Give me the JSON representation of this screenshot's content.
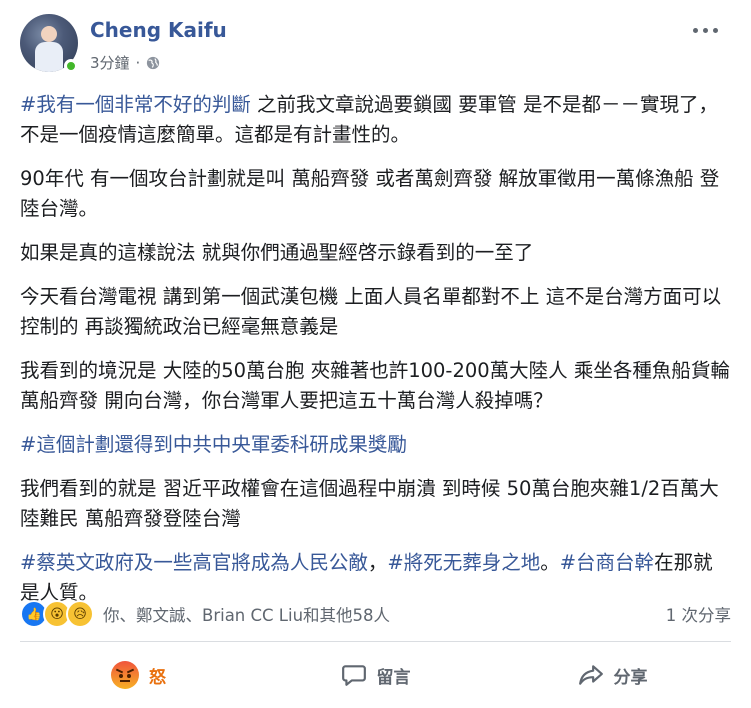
{
  "post": {
    "author": "Cheng Kaifu",
    "time": "3分鐘",
    "dot": "·",
    "privacy_icon": "globe-icon",
    "more_icon": "more-options-icon"
  },
  "content": {
    "paragraphs": [
      {
        "hashtag": "#我有一個非常不好的判斷",
        "text": " 之前我文章說過要鎖國 要軍管 是不是都－－實現了，不是一個疫情這麼簡單。這都是有計畫性的。"
      },
      {
        "text": "90年代 有一個攻台計劃就是叫 萬船齊發 或者萬劍齊發 解放軍徵用一萬條漁船 登陸台灣。"
      },
      {
        "text": "如果是真的這樣說法 就與你們通過聖經啓示錄看到的一至了"
      },
      {
        "text": "今天看台灣電視 講到第一個武漢包機 上面人員名單都對不上 這不是台灣方面可以控制的 再談獨統政治已經毫無意義是"
      },
      {
        "text": "我看到的境況是 大陸的50萬台胞 夾雜著也許100-200萬大陸人 乘坐各種魚船貨輪 萬船齊發 開向台灣，你台灣軍人要把這五十萬台灣人殺掉嗎？"
      },
      {
        "hashtag": "#這個計劃還得到中共中央軍委科研成果獎勵",
        "text": ""
      },
      {
        "text": "我們看到的就是 習近平政權會在這個過程中崩潰 到時候 50萬台胞夾雜1/2百萬大陸難民 萬船齊發登陸台灣"
      }
    ],
    "last": {
      "tag1": "#蔡英文政府及一些高官將成為人民公敵",
      "sep1": "，",
      "tag2": "#將死无葬身之地",
      "sep2": "。",
      "tag3": "#台商台幹",
      "text": "在那就是人質。"
    }
  },
  "reactions": {
    "icons": [
      "like-icon",
      "wow-icon",
      "sad-icon"
    ],
    "summary": "你、鄭文誠、Brian CC Liu和其他58人",
    "shares": "1 次分享"
  },
  "actions": {
    "angry": "怒",
    "comment": "留言",
    "share": "分享"
  }
}
